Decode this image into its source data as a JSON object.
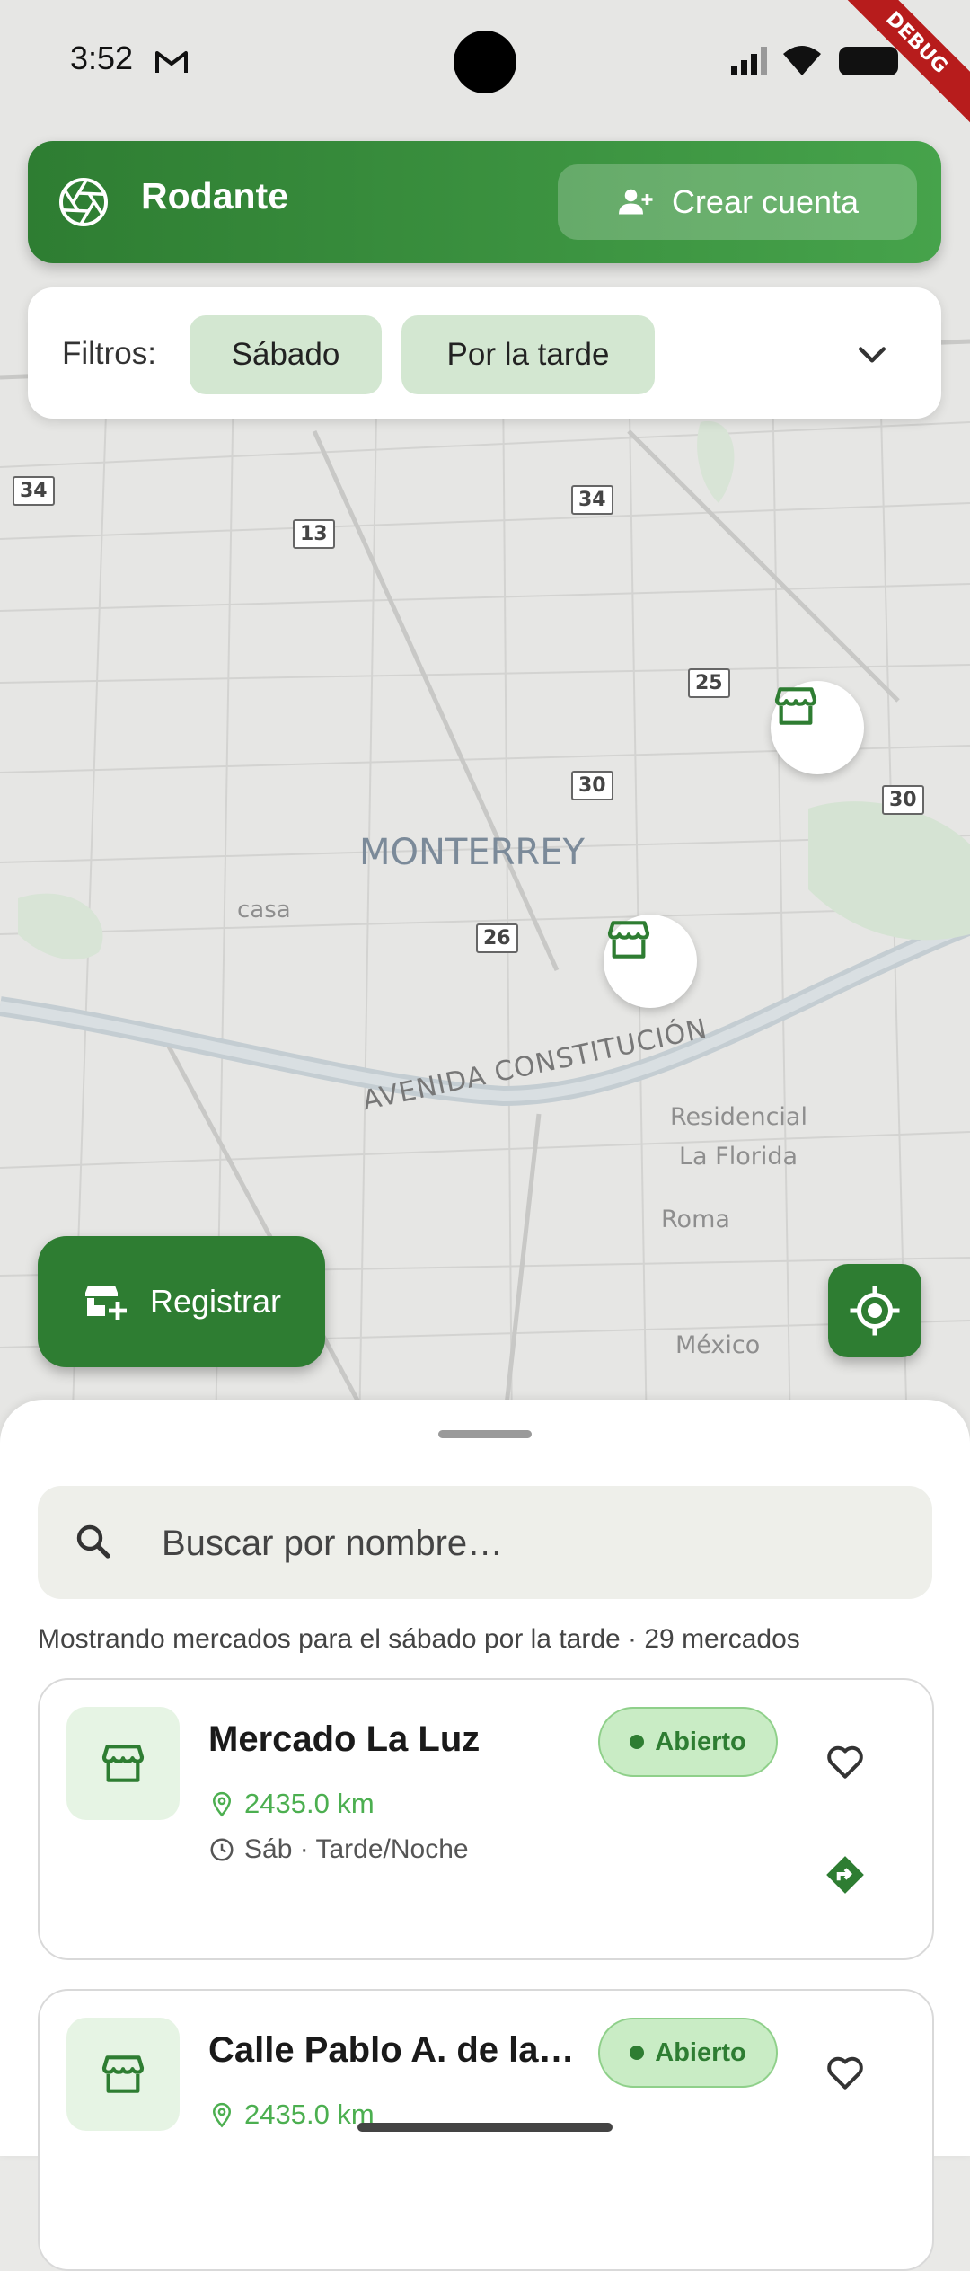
{
  "status_bar": {
    "time": "3:52",
    "debug": "DEBUG"
  },
  "app_bar": {
    "logo_icon": "aperture-icon",
    "title": "Rodante",
    "create_account_label": "Crear cuenta",
    "create_account_icon": "person-add-icon"
  },
  "filters": {
    "label": "Filtros:",
    "chips": [
      "Sábado",
      "Por la tarde"
    ]
  },
  "map": {
    "city": "MONTERREY",
    "avenue": "AVENIDA CONSTITUCIÓN",
    "areas": [
      "casa",
      "Residencial",
      "La Florida",
      "Roma",
      "México"
    ],
    "road_badges": [
      "34",
      "13",
      "34",
      "25",
      "30",
      "30",
      "26"
    ]
  },
  "fab": {
    "register_label": "Registrar"
  },
  "sheet": {
    "search_placeholder": "Buscar por nombre…",
    "summary": "Mostrando mercados para el sábado por la tarde · 29 mercados",
    "markets": [
      {
        "name": "Mercado La Luz",
        "status": "Abierto",
        "distance": "2435.0 km",
        "schedule": "Sáb · Tarde/Noche"
      },
      {
        "name": "Calle Pablo A. de la…",
        "status": "Abierto",
        "distance": "2435.0 km"
      }
    ]
  },
  "colors": {
    "primary": "#2e7d32",
    "primary_light": "#46a34b",
    "chip_bg": "#d3e7d1",
    "status_bg": "#c9ecc5",
    "distance": "#4caf50"
  }
}
